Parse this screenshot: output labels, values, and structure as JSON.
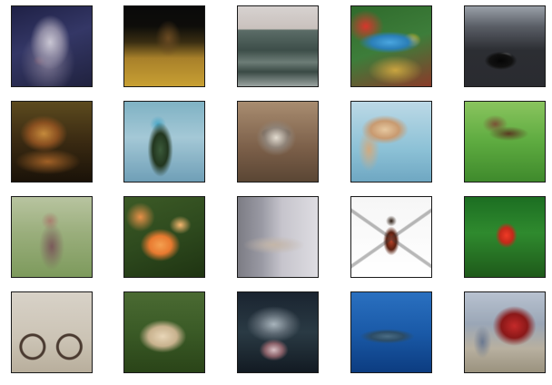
{
  "background_color": "#ffffff",
  "tile_border_color": "#1a1a1a",
  "grid": {
    "rows": 4,
    "columns": 5
  }
}
